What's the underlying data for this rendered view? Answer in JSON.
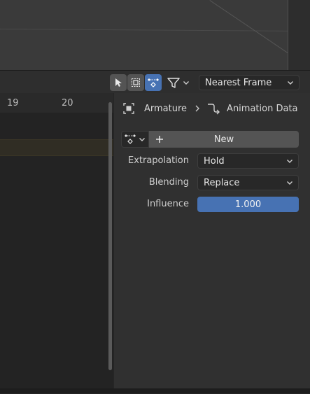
{
  "header": {
    "snap_dropdown": "Nearest Frame"
  },
  "timeline": {
    "frames": [
      "19",
      "20"
    ]
  },
  "sidebar": {
    "breadcrumb": {
      "object": "Armature",
      "data": "Animation Data"
    },
    "action_new_label": "New",
    "extrapolation": {
      "label": "Extrapolation",
      "value": "Hold"
    },
    "blending": {
      "label": "Blending",
      "value": "Replace"
    },
    "influence": {
      "label": "Influence",
      "value": "1.000"
    }
  },
  "colors": {
    "accent": "#4772b3"
  }
}
